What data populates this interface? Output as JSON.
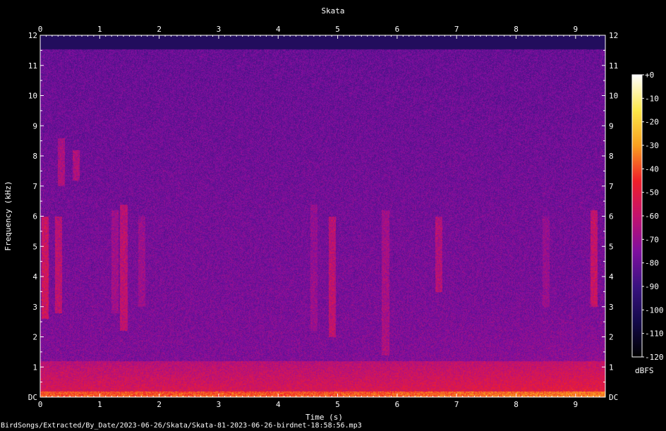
{
  "chart_data": {
    "type": "heatmap",
    "title": "Skata",
    "xlabel": "Time (s)",
    "ylabel": "Frequency (kHz)",
    "x_ticks": [
      "0",
      "1",
      "2",
      "3",
      "4",
      "5",
      "6",
      "7",
      "8",
      "9"
    ],
    "y_ticks": [
      "DC",
      "1",
      "2",
      "3",
      "4",
      "5",
      "6",
      "7",
      "8",
      "9",
      "10",
      "11",
      "12"
    ],
    "xlim": [
      0,
      9.5
    ],
    "ylim": [
      0,
      12
    ],
    "colorbar": {
      "unit": "dBFS",
      "ticks": [
        "+0",
        "-10",
        "-20",
        "-30",
        "-40",
        "-50",
        "-60",
        "-70",
        "-80",
        "-90",
        "-100",
        "-110",
        "-120"
      ],
      "range": [
        -120,
        0
      ],
      "colors": [
        "#000000",
        "#140a4a",
        "#3a1380",
        "#7f0fa0",
        "#c4126f",
        "#f0202a",
        "#f9a020",
        "#fde84a",
        "#ffffff"
      ]
    },
    "filename": "BirdSongs/Extracted/By_Date/2023-06-26/Skata/Skata-81-2023-06-26-birdnet-18:58:56.mp3"
  }
}
